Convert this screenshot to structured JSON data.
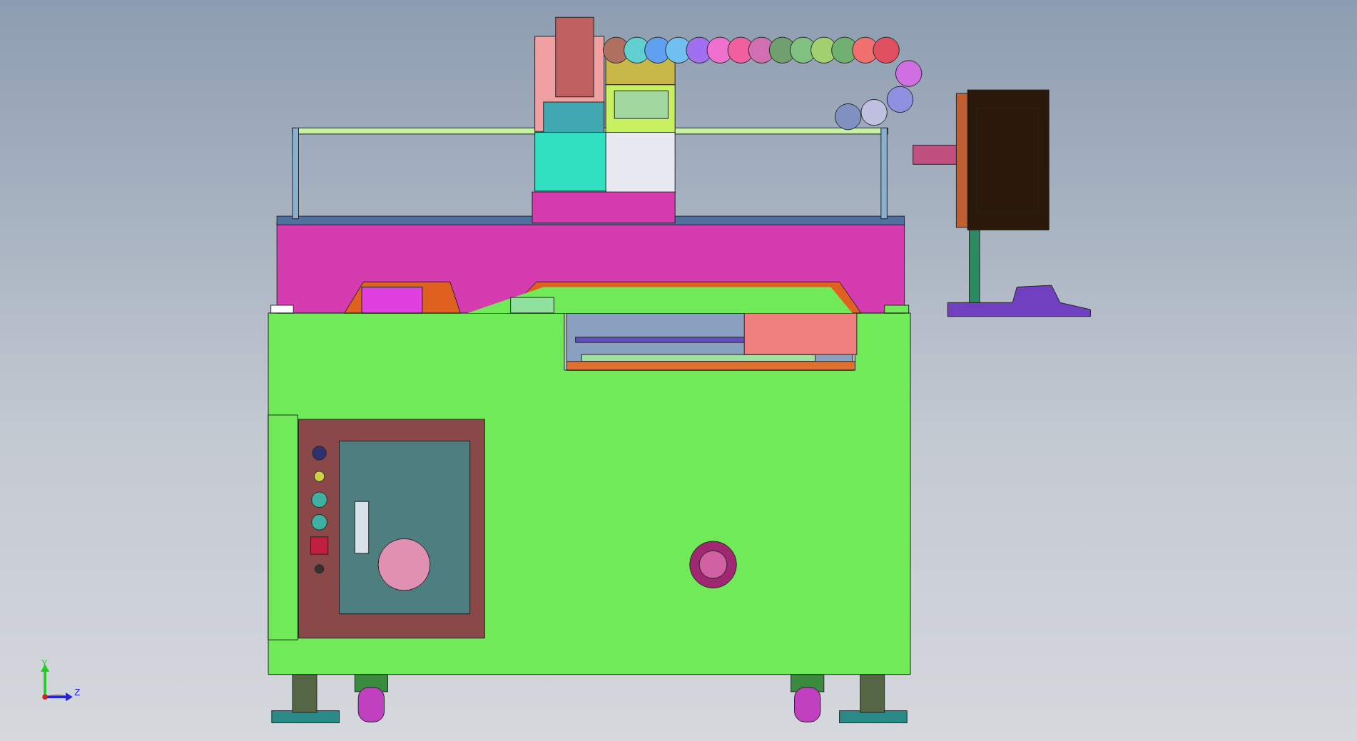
{
  "viewport": {
    "triad": {
      "axes": [
        {
          "label": "Y",
          "color": "#22cc22"
        },
        {
          "label": "Z",
          "color": "#2222dd"
        }
      ]
    }
  }
}
